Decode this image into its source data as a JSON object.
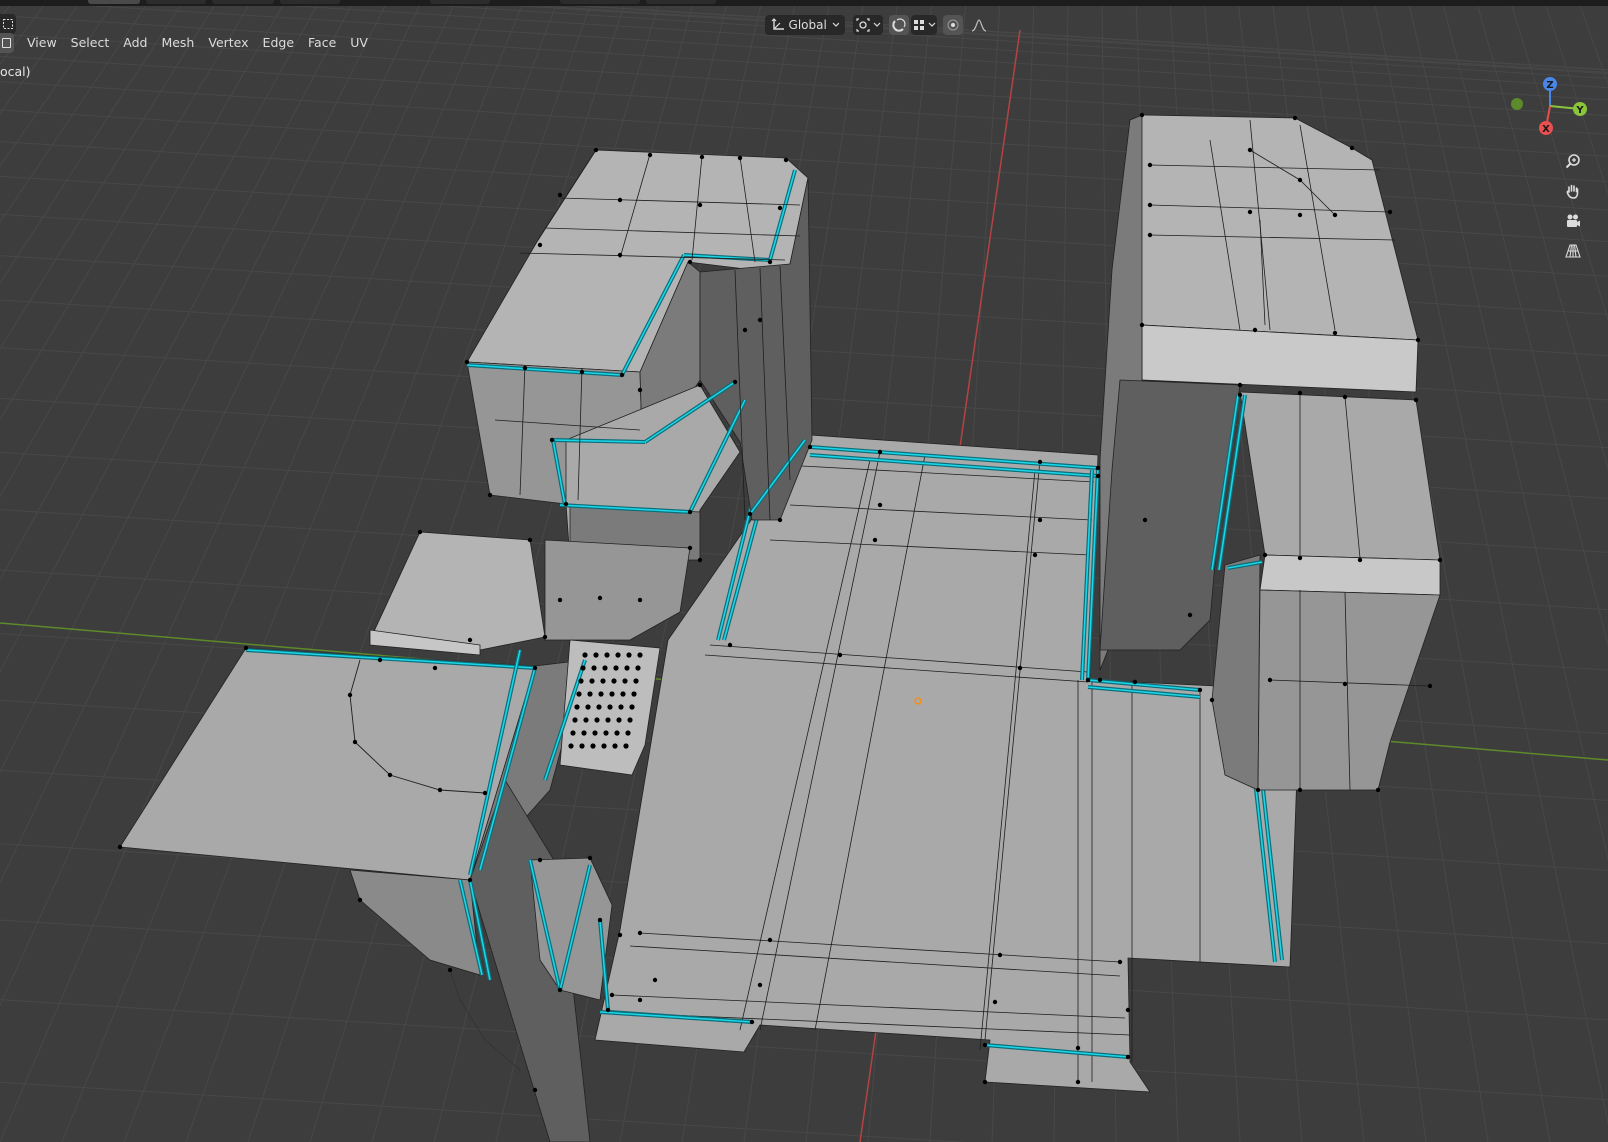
{
  "header": {
    "orientation": {
      "label": "Global",
      "icon": "transform-orientation-icon",
      "chevron": "chevron-down-icon"
    },
    "pivot": {
      "icon": "pivot-point-icon",
      "chevron": "chevron-down-icon"
    },
    "snapping": {
      "icon": "snap-magnet-icon",
      "increment_icon": "snap-increment-icon",
      "chevron": "chevron-down-icon"
    },
    "proportional_editing": {
      "icon": "proportional-edit-icon",
      "falloff_icon": "falloff-curve-icon"
    }
  },
  "menu": {
    "items": [
      "View",
      "Select",
      "Add",
      "Mesh",
      "Vertex",
      "Edge",
      "Face",
      "UV"
    ]
  },
  "viewport": {
    "view_label": "ocal)",
    "gizmo": {
      "z": "Z",
      "y": "Y",
      "x": "X"
    },
    "nav_buttons": [
      "zoom-icon",
      "hand-pan-icon",
      "camera-icon",
      "perspective-grid-icon"
    ]
  },
  "colors": {
    "background": "#3d3d3d",
    "grid_line": "#484848",
    "axis_x": "#c83e3e",
    "axis_y": "#6a9a2e",
    "mesh_face": "#a7a7a7",
    "mesh_face_dark": "#7f7f7f",
    "seam_highlight": "#19d6e8",
    "vertex": "#000000",
    "origin": "#ff8c00",
    "gizmo_x": "#e94f4f",
    "gizmo_y": "#8bc53a",
    "gizmo_z": "#4a86e8"
  }
}
